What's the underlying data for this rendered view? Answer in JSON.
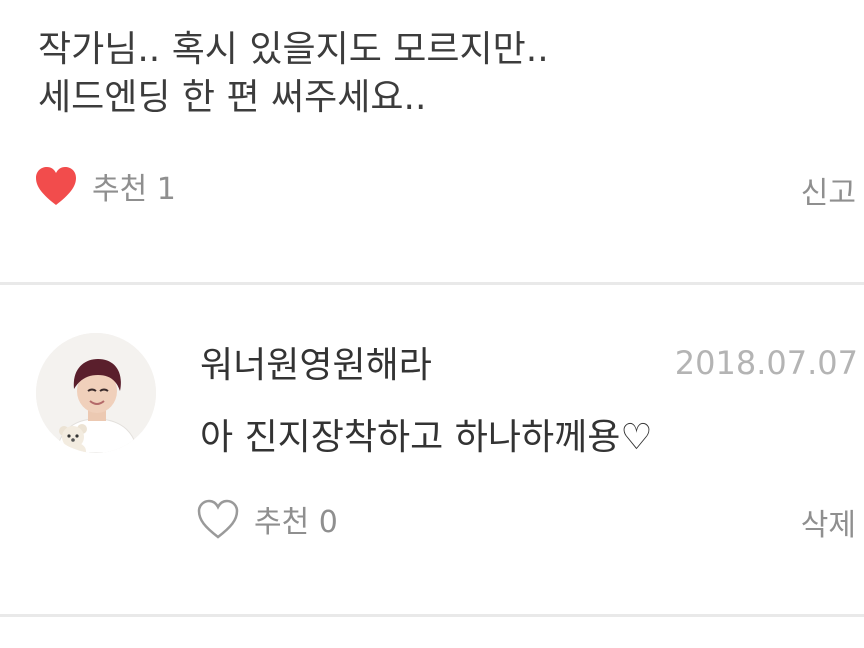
{
  "first_comment": {
    "lines": [
      "작가님.. 혹시 있을지도 모르지만..",
      "세드엔딩 한 편 써주세요.."
    ],
    "like_label": "추천 1",
    "like_icon": "heart-filled-icon",
    "like_color": "#f24c4c",
    "report_label": "신고"
  },
  "second_comment": {
    "author": "워너원영원해라",
    "date": "2018.07.07",
    "text": "아 진지장착하고 하나하께용♡",
    "like_label": "추천 0",
    "like_icon": "heart-outline-icon",
    "delete_label": "삭제"
  }
}
